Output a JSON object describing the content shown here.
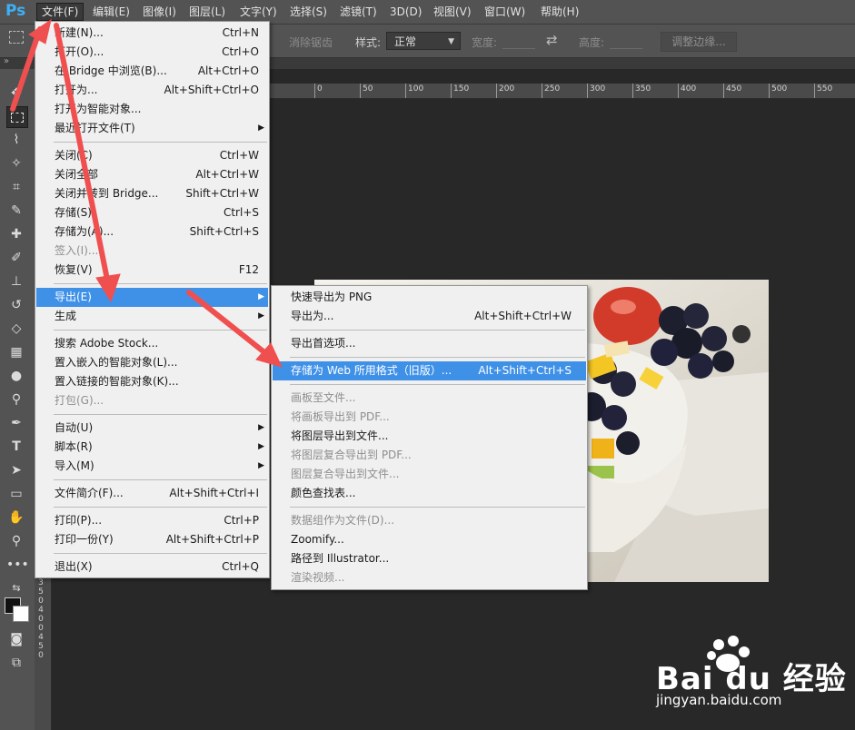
{
  "app": {
    "logo": "Ps"
  },
  "menubar": [
    {
      "label": "文件(F)",
      "active": true
    },
    {
      "label": "编辑(E)"
    },
    {
      "label": "图像(I)"
    },
    {
      "label": "图层(L)"
    },
    {
      "label": "文字(Y)"
    },
    {
      "label": "选择(S)"
    },
    {
      "label": "滤镜(T)"
    },
    {
      "label": "3D(D)"
    },
    {
      "label": "视图(V)"
    },
    {
      "label": "窗口(W)"
    },
    {
      "label": "帮助(H)"
    }
  ],
  "options": {
    "antialias": "消除锯齿",
    "style_label": "样式:",
    "style_value": "正常",
    "width_label": "宽度:",
    "height_label": "高度:",
    "adjust_edge": "调整边缘..."
  },
  "file_menu": [
    {
      "label": "新建(N)...",
      "shortcut": "Ctrl+N"
    },
    {
      "label": "打开(O)...",
      "shortcut": "Ctrl+O"
    },
    {
      "label": "在 Bridge 中浏览(B)...",
      "shortcut": "Alt+Ctrl+O"
    },
    {
      "label": "打开为...",
      "shortcut": "Alt+Shift+Ctrl+O"
    },
    {
      "label": "打开为智能对象..."
    },
    {
      "label": "最近打开文件(T)",
      "submenu": true
    },
    {
      "sep": true
    },
    {
      "label": "关闭(C)",
      "shortcut": "Ctrl+W"
    },
    {
      "label": "关闭全部",
      "shortcut": "Alt+Ctrl+W"
    },
    {
      "label": "关闭并转到 Bridge...",
      "shortcut": "Shift+Ctrl+W"
    },
    {
      "label": "存储(S)",
      "shortcut": "Ctrl+S"
    },
    {
      "label": "存储为(A)...",
      "shortcut": "Shift+Ctrl+S"
    },
    {
      "label": "签入(I)...",
      "disabled": true
    },
    {
      "label": "恢复(V)",
      "shortcut": "F12"
    },
    {
      "sep": true
    },
    {
      "label": "导出(E)",
      "submenu": true,
      "highlighted": true
    },
    {
      "label": "生成",
      "submenu": true
    },
    {
      "sep": true
    },
    {
      "label": "搜索 Adobe Stock..."
    },
    {
      "label": "置入嵌入的智能对象(L)..."
    },
    {
      "label": "置入链接的智能对象(K)..."
    },
    {
      "label": "打包(G)...",
      "disabled": true
    },
    {
      "sep": true
    },
    {
      "label": "自动(U)",
      "submenu": true
    },
    {
      "label": "脚本(R)",
      "submenu": true
    },
    {
      "label": "导入(M)",
      "submenu": true
    },
    {
      "sep": true
    },
    {
      "label": "文件简介(F)...",
      "shortcut": "Alt+Shift+Ctrl+I"
    },
    {
      "sep": true
    },
    {
      "label": "打印(P)...",
      "shortcut": "Ctrl+P"
    },
    {
      "label": "打印一份(Y)",
      "shortcut": "Alt+Shift+Ctrl+P"
    },
    {
      "sep": true
    },
    {
      "label": "退出(X)",
      "shortcut": "Ctrl+Q"
    }
  ],
  "export_menu": [
    {
      "label": "快速导出为 PNG"
    },
    {
      "label": "导出为...",
      "shortcut": "Alt+Shift+Ctrl+W"
    },
    {
      "sep": true
    },
    {
      "label": "导出首选项..."
    },
    {
      "sep": true
    },
    {
      "label": "存储为 Web 所用格式（旧版）...",
      "shortcut": "Alt+Shift+Ctrl+S",
      "highlighted": true
    },
    {
      "sep": true
    },
    {
      "label": "画板至文件...",
      "disabled": true
    },
    {
      "label": "将画板导出到 PDF...",
      "disabled": true
    },
    {
      "label": "将图层导出到文件..."
    },
    {
      "label": "将图层复合导出到 PDF...",
      "disabled": true
    },
    {
      "label": "图层复合导出到文件...",
      "disabled": true
    },
    {
      "label": "颜色查找表..."
    },
    {
      "sep": true
    },
    {
      "label": "数据组作为文件(D)...",
      "disabled": true
    },
    {
      "label": "Zoomify..."
    },
    {
      "label": "路径到 Illustrator..."
    },
    {
      "label": "渲染视频...",
      "disabled": true
    }
  ],
  "ruler": {
    "top": [
      "0",
      "50",
      "100",
      "150",
      "200",
      "250",
      "300",
      "350",
      "400",
      "450",
      "500",
      "550"
    ],
    "left": [
      "3",
      "5",
      "0",
      "4",
      "0",
      "0",
      "4",
      "5",
      "0"
    ]
  },
  "watermark": {
    "brand": "Bai du 经验",
    "url": "jingyan.baidu.com"
  },
  "colors": {
    "accent": "#3f91e8",
    "menubar": "#535353",
    "canvas": "#282828"
  }
}
